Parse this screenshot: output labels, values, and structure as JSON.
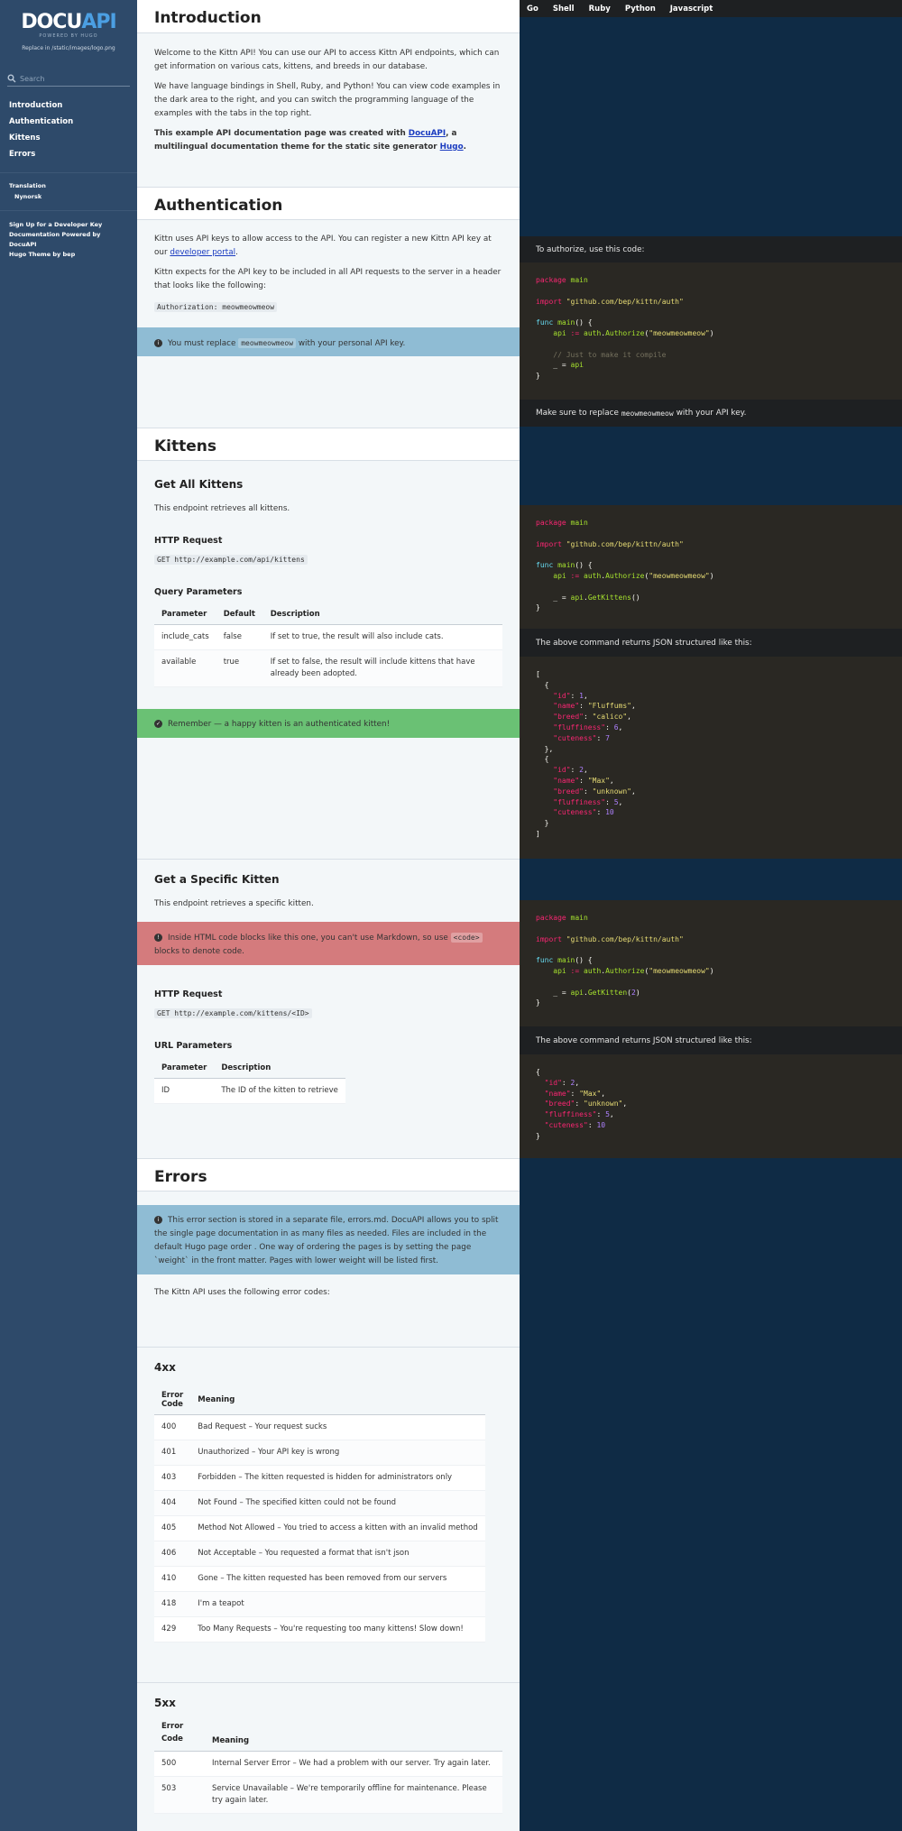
{
  "sidebar": {
    "logo_main": "DOCU",
    "logo_accent": "API",
    "logo_sub": "POWERED BY HUGO",
    "logo_hint": "Replace in /static/images/logo.png",
    "search_placeholder": "Search",
    "toc": [
      "Introduction",
      "Authentication",
      "Kittens",
      "Errors"
    ],
    "translation_label": "Translation",
    "translation_lang": "Nynorsk",
    "footer_links": [
      "Sign Up for a Developer Key",
      "Documentation Powered by DocuAPI",
      "Hugo Theme by bep"
    ]
  },
  "tabs": [
    "Go",
    "Shell",
    "Ruby",
    "Python",
    "Javascript"
  ],
  "intro": {
    "title": "Introduction",
    "p1": "Welcome to the Kittn API! You can use our API to access Kittn API endpoints, which can get information on various cats, kittens, and breeds in our database.",
    "p2": "We have language bindings in Shell, Ruby, and Python! You can view code examples in the dark area to the right, and you can switch the programming language of the examples with the tabs in the top right.",
    "p3_a": "This example API documentation page was created with ",
    "p3_link1": "DocuAPI",
    "p3_b": ", a multilingual documentation theme for the static site generator ",
    "p3_link2": "Hugo",
    "p3_c": "."
  },
  "auth": {
    "title": "Authentication",
    "p1_a": "Kittn uses API keys to allow access to the API. You can register a new Kittn API key at our ",
    "p1_link": "developer portal",
    "p1_b": ".",
    "p2": "Kittn expects for the API key to be included in all API requests to the server in a header that looks like the following:",
    "header_code": "Authorization: meowmeowmeow",
    "notice_a": "You must replace ",
    "notice_code": "meowmeowmeow",
    "notice_b": " with your personal API key.",
    "code_intro": "To authorize, use this code:",
    "code_after_a": "Make sure to replace ",
    "code_after_code": "meowmeowmeow",
    "code_after_b": " with your API key."
  },
  "kittens": {
    "title": "Kittens",
    "get_all": {
      "title": "Get All Kittens",
      "desc": "This endpoint retrieves all kittens.",
      "http_title": "HTTP Request",
      "http": "GET http://example.com/api/kittens",
      "qp_title": "Query Parameters",
      "headers": [
        "Parameter",
        "Default",
        "Description"
      ],
      "rows": [
        [
          "include_cats",
          "false",
          "If set to true, the result will also include cats."
        ],
        [
          "available",
          "true",
          "If set to false, the result will include kittens that have already been adopted."
        ]
      ],
      "notice": "Remember — a happy kitten is an authenticated kitten!",
      "json_intro": "The above command returns JSON structured like this:"
    },
    "get_one": {
      "title": "Get a Specific Kitten",
      "desc": "This endpoint retrieves a specific kitten.",
      "notice_a": "Inside HTML code blocks like this one, you can't use Markdown, so use ",
      "notice_code": "<code>",
      "notice_b": " blocks to denote code.",
      "http_title": "HTTP Request",
      "http": "GET http://example.com/kittens/<ID>",
      "up_title": "URL Parameters",
      "headers": [
        "Parameter",
        "Description"
      ],
      "rows": [
        [
          "ID",
          "The ID of the kitten to retrieve"
        ]
      ],
      "json_intro": "The above command returns JSON structured like this:"
    }
  },
  "errors": {
    "title": "Errors",
    "notice": "This error section is stored in a separate file, errors.md. DocuAPI allows you to split the single page documentation in as many files as needed. Files are included in the default Hugo page order . One way of ordering the pages is by setting the page `weight` in the front matter. Pages with lower weight will be listed first.",
    "intro": "The Kittn API uses the following error codes:",
    "h4xx": "4xx",
    "h5xx": "5xx",
    "headers": [
      "Error Code",
      "Meaning"
    ],
    "rows4xx": [
      [
        "400",
        "Bad Request – Your request sucks"
      ],
      [
        "401",
        "Unauthorized – Your API key is wrong"
      ],
      [
        "403",
        "Forbidden – The kitten requested is hidden for administrators only"
      ],
      [
        "404",
        "Not Found – The specified kitten could not be found"
      ],
      [
        "405",
        "Method Not Allowed – You tried to access a kitten with an invalid method"
      ],
      [
        "406",
        "Not Acceptable – You requested a format that isn't json"
      ],
      [
        "410",
        "Gone – The kitten requested has been removed from our servers"
      ],
      [
        "418",
        "I'm a teapot"
      ],
      [
        "429",
        "Too Many Requests – You're requesting too many kittens! Slow down!"
      ]
    ],
    "rows5xx": [
      [
        "500",
        "Internal Server Error – We had a problem with our server. Try again later."
      ],
      [
        "503",
        "Service Unavailable – We're temporarily offline for maintenance. Please try again later."
      ]
    ]
  }
}
